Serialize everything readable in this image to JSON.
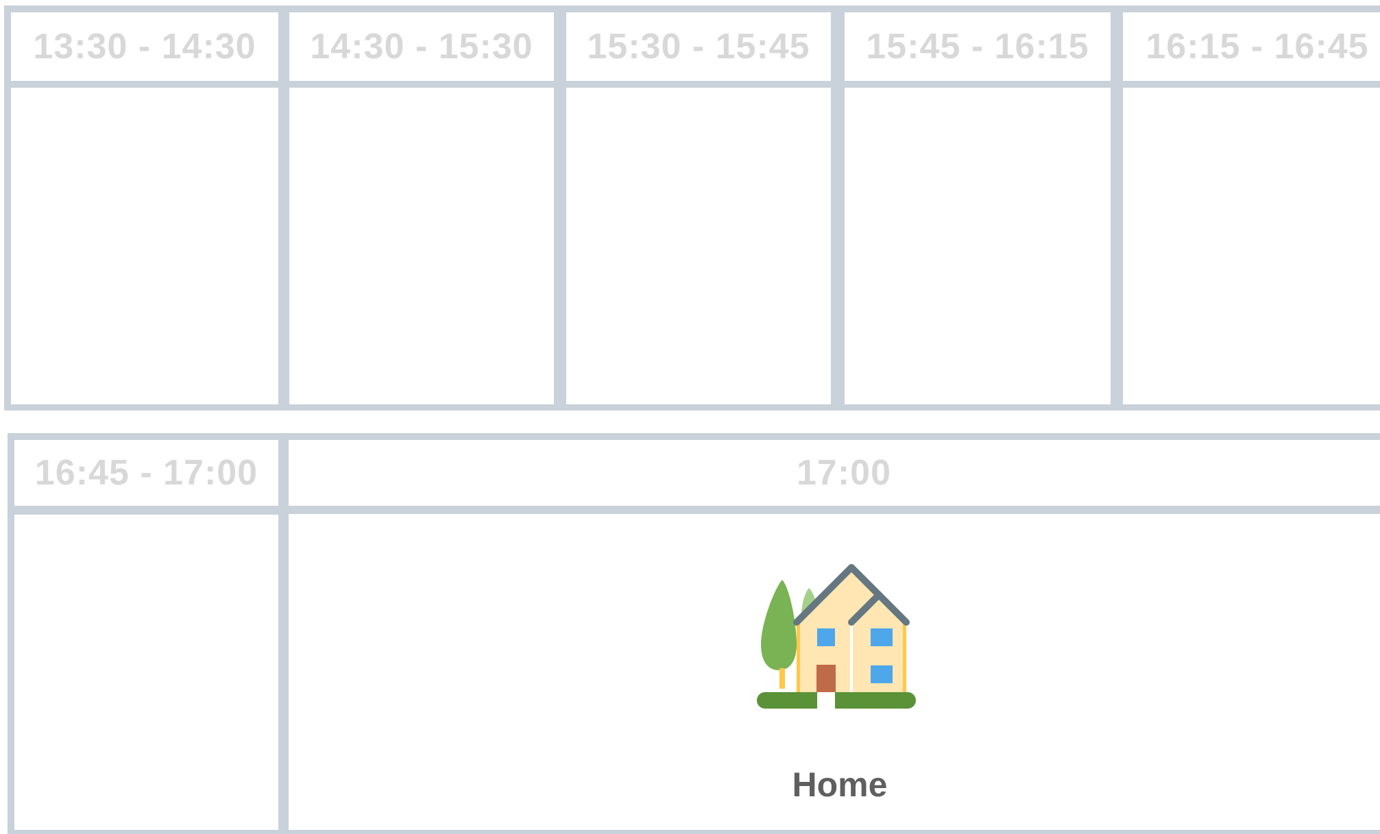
{
  "row1": {
    "slots": [
      {
        "time": "13:30 - 14:30"
      },
      {
        "time": "14:30 - 15:30"
      },
      {
        "time": "15:30 - 15:45"
      },
      {
        "time": "15:45 - 16:15"
      },
      {
        "time": "16:15 - 16:45"
      }
    ]
  },
  "row2": {
    "slots": [
      {
        "time": "16:45 - 17:00"
      },
      {
        "time": "17:00",
        "icon": "house-icon",
        "label": "Home"
      }
    ]
  },
  "colors": {
    "frame": "#c9d1da",
    "header_text": "#d8d8d8",
    "label_text": "#5f5f5f"
  }
}
